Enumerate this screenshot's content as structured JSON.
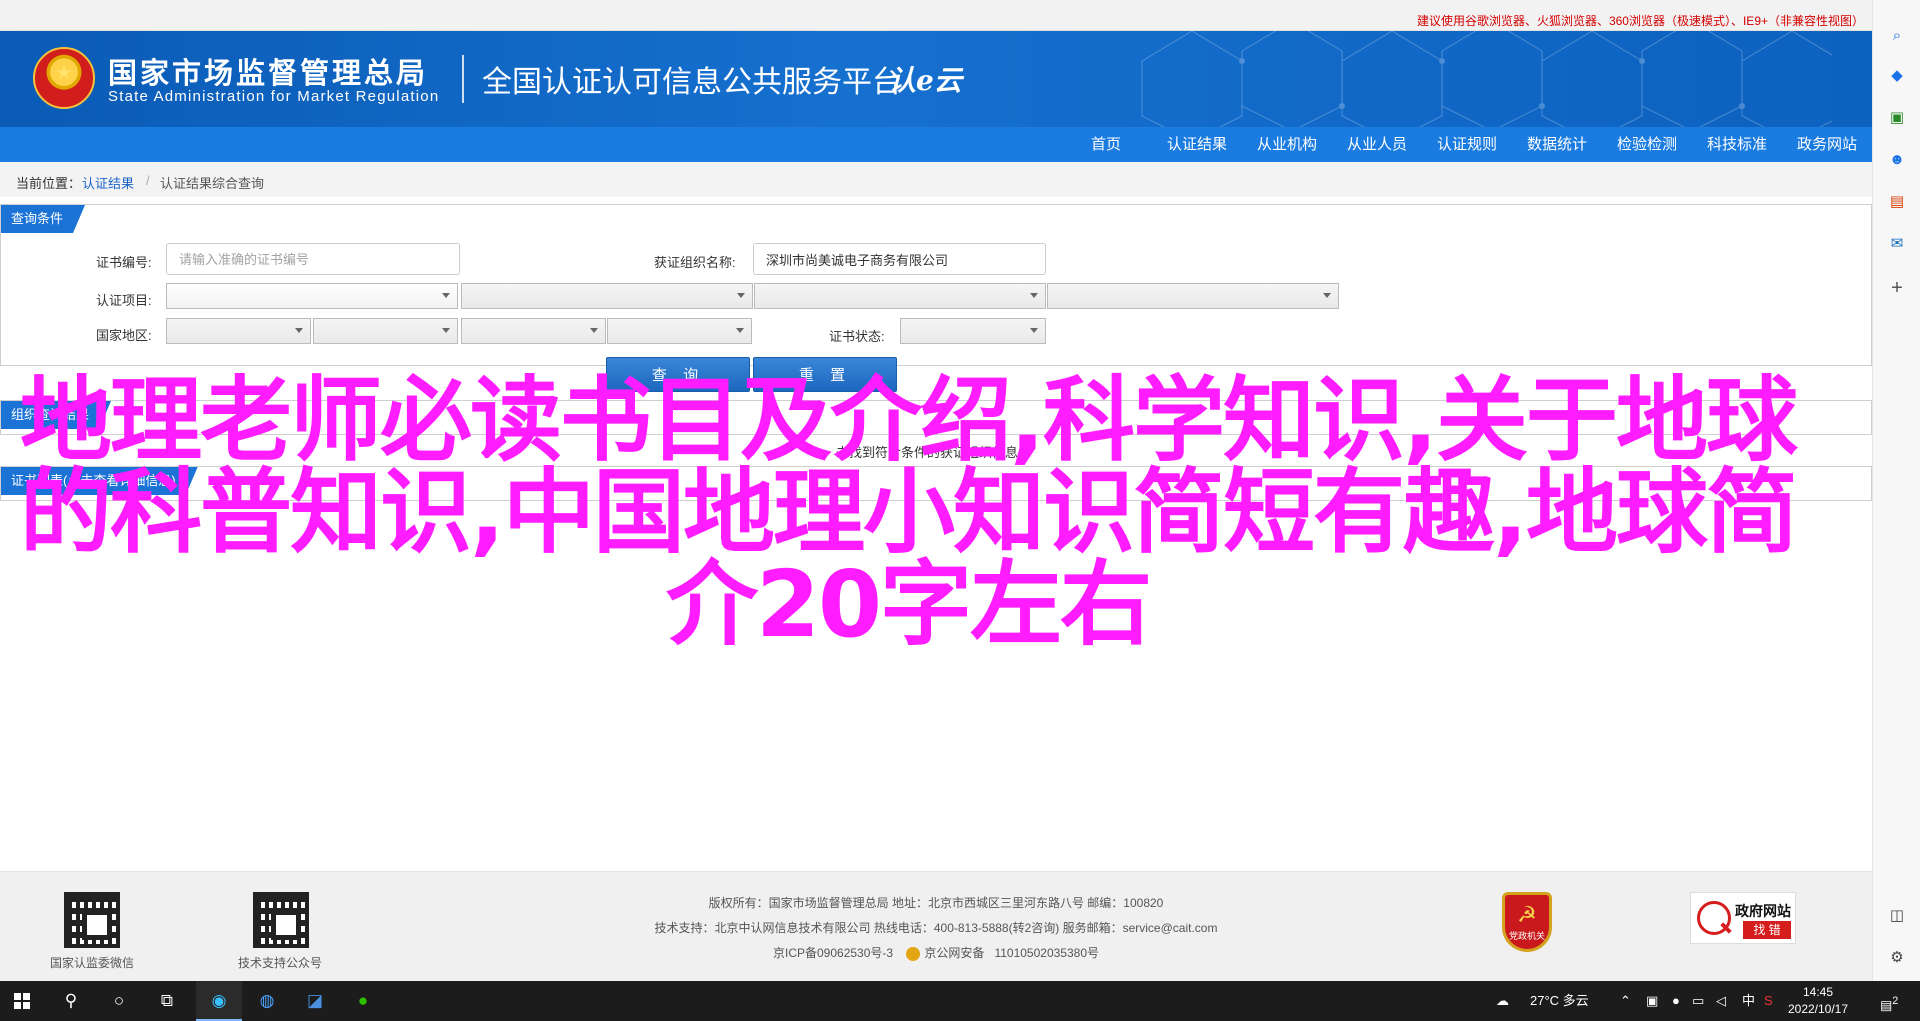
{
  "top_notice": "建议使用谷歌浏览器、火狐浏览器、360浏览器（极速模式）、IE9+（非兼容性视图）",
  "header": {
    "org_cn": "国家市场监督管理总局",
    "org_en": "State Administration  for  Market Regulation",
    "platform": "全国认证认可信息公共服务平台",
    "cert_logo": "认e云"
  },
  "nav": [
    "首页",
    "认证结果",
    "从业机构",
    "从业人员",
    "认证规则",
    "数据统计",
    "检验检测",
    "科技标准",
    "政务网站"
  ],
  "breadcrumb": {
    "label": "当前位置：",
    "link": "认证结果",
    "sep": "/",
    "current": "认证结果综合查询"
  },
  "query": {
    "title": "查询条件",
    "cert_no_label": "证书编号:",
    "cert_no_placeholder": "请输入准确的证书编号",
    "org_label": "获证组织名称:",
    "org_value": "深圳市尚美诚电子商务有限公司",
    "project_label": "认证项目:",
    "region_label": "国家地区:",
    "status_label": "证书状态:",
    "search_btn": "查 询",
    "reset_btn": "重 置"
  },
  "result_panel": {
    "title": "组织查询结果",
    "note": "未找到符合条件的获证组织信息"
  },
  "list_panel": {
    "title": "证书列表(点击查看详细信息)"
  },
  "overlay_text": "地理老师必读书目及介绍,科学知识,关于地球的科普知识,中国地理小知识简短有趣,地球简介20字左右",
  "footer": {
    "qr1_caption": "国家认监委微信",
    "qr2_caption": "技术支持公众号",
    "line1": "版权所有：国家市场监督管理总局     地址：北京市西城区三里河东路八号     邮编：100820",
    "line2": "技术支持：北京中认网信息技术有限公司     热线电话：400-813-5888(转2咨询)     服务邮箱：service@cait.com",
    "icp": "京ICP备09062530号-3",
    "police": "京公网安备",
    "police_no": "11010502035380号",
    "party_badge": "党政机关",
    "gov_t1": "政府网站",
    "gov_t2": "找 错"
  },
  "taskbar": {
    "weather": "27°C 多云",
    "ime": "中",
    "time": "14:45",
    "date": "2022/10/17",
    "notif_count": "2"
  },
  "colors": {
    "header_blue": "#0d61bf",
    "nav_blue": "#1a7be0",
    "overlay_magenta": "#ff1cff",
    "notice_red": "#d40000"
  }
}
